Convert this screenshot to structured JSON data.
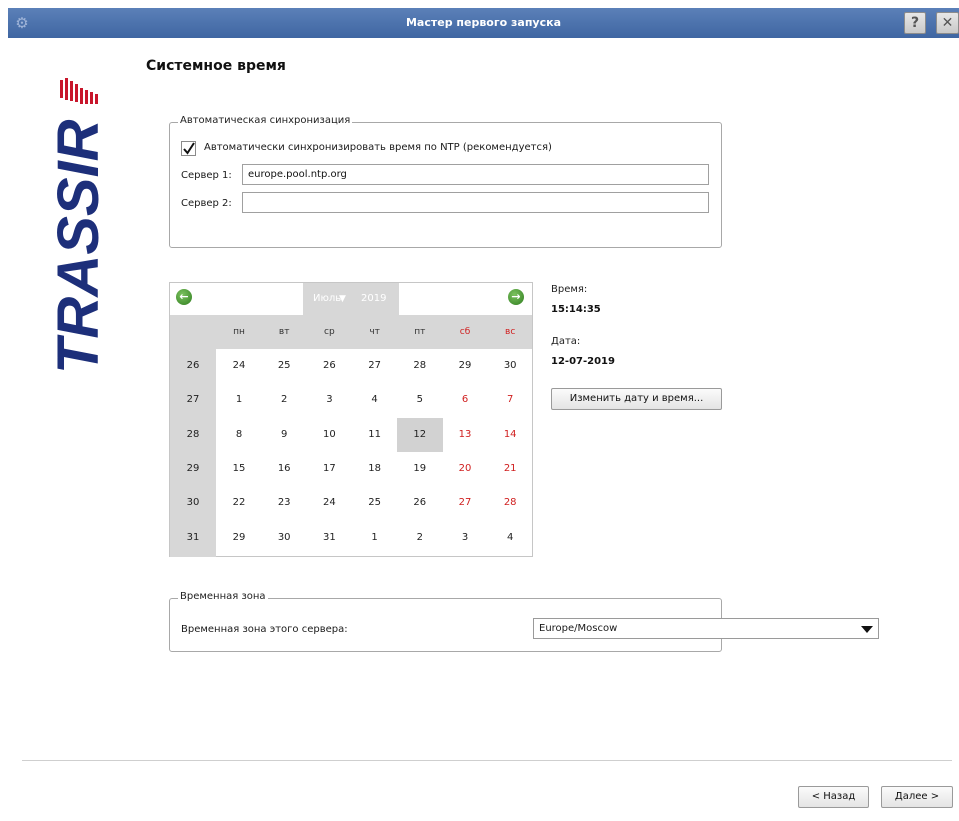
{
  "window": {
    "title": "Мастер первого запуска",
    "help_label": "?",
    "close_label": "✕"
  },
  "page": {
    "title": "Системное время"
  },
  "logo": {
    "text": "TRASSIR"
  },
  "sync": {
    "group_title": "Автоматическая синхронизация",
    "checkbox_label": "Автоматически синхронизировать время по NTP (рекомендуется)",
    "checked": true,
    "server1_label": "Сервер 1:",
    "server1_value": "europe.pool.ntp.org",
    "server2_label": "Сервер 2:",
    "server2_value": ""
  },
  "calendar": {
    "month": "Июль",
    "year": "2019",
    "weekdays": [
      "пн",
      "вт",
      "ср",
      "чт",
      "пт",
      "сб",
      "вс"
    ],
    "weeks": [
      {
        "week": "26",
        "days": [
          "24",
          "25",
          "26",
          "27",
          "28",
          "29",
          "30"
        ]
      },
      {
        "week": "27",
        "days": [
          "1",
          "2",
          "3",
          "4",
          "5",
          "6",
          "7"
        ]
      },
      {
        "week": "28",
        "days": [
          "8",
          "9",
          "10",
          "11",
          "12",
          "13",
          "14"
        ]
      },
      {
        "week": "29",
        "days": [
          "15",
          "16",
          "17",
          "18",
          "19",
          "20",
          "21"
        ]
      },
      {
        "week": "30",
        "days": [
          "22",
          "23",
          "24",
          "25",
          "26",
          "27",
          "28"
        ]
      },
      {
        "week": "31",
        "days": [
          "29",
          "30",
          "31",
          "1",
          "2",
          "3",
          "4"
        ]
      }
    ],
    "selected_day": "12",
    "weekend_color": "#d02020"
  },
  "datetime": {
    "time_label": "Время:",
    "time_value": "15:14:35",
    "date_label": "Дата:",
    "date_value": "12-07-2019",
    "change_button": "Изменить дату и время..."
  },
  "timezone": {
    "group_title": "Временная зона",
    "label": "Временная зона этого сервера:",
    "value": "Europe/Moscow"
  },
  "footer": {
    "back_label": "< Назад",
    "next_label": "Далее >"
  }
}
